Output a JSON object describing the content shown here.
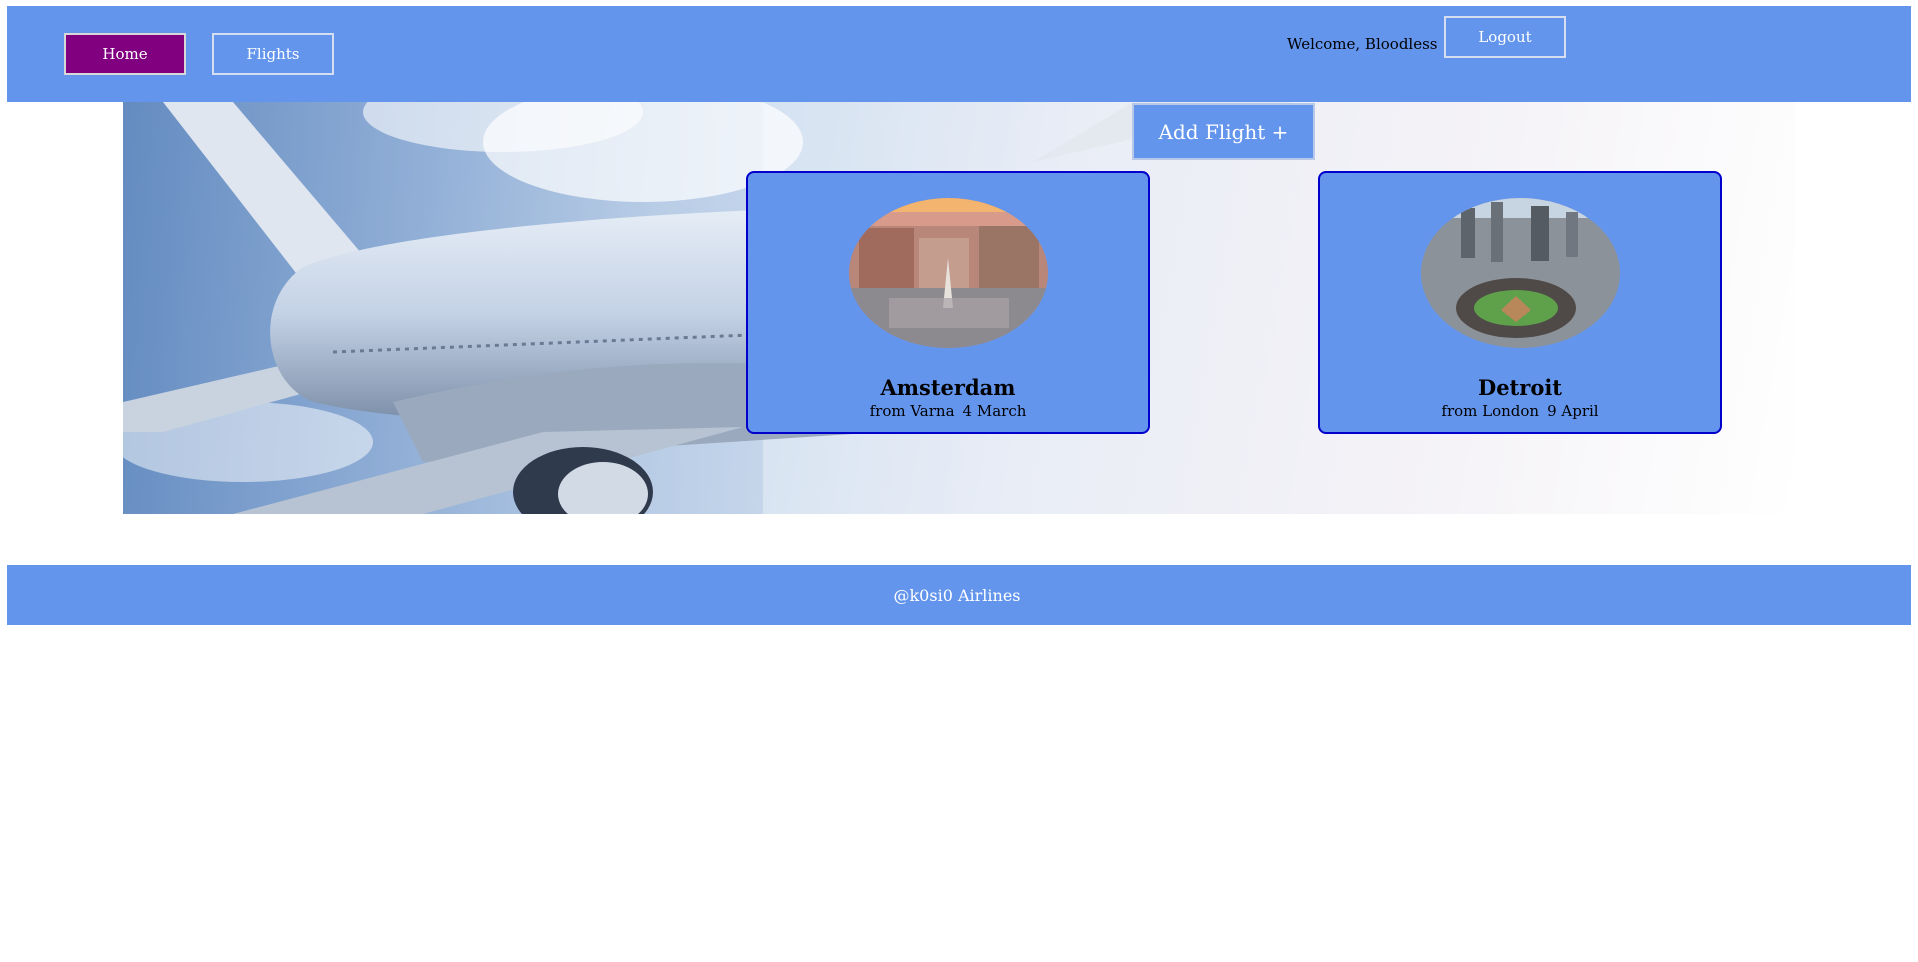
{
  "nav": {
    "home_label": "Home",
    "flights_label": "Flights",
    "welcome_text": "Welcome, Bloodless",
    "logout_label": "Logout"
  },
  "add_flight_label": "Add Flight +",
  "flights": [
    {
      "city": "Amsterdam",
      "from": "from Varna",
      "date": "4 March"
    },
    {
      "city": "Detroit",
      "from": "from London",
      "date": "9 April"
    }
  ],
  "footer_text": "@k0si0 Airlines",
  "colors": {
    "header": "#6495ed",
    "active_nav": "#800080",
    "card_border": "#0000cd"
  }
}
